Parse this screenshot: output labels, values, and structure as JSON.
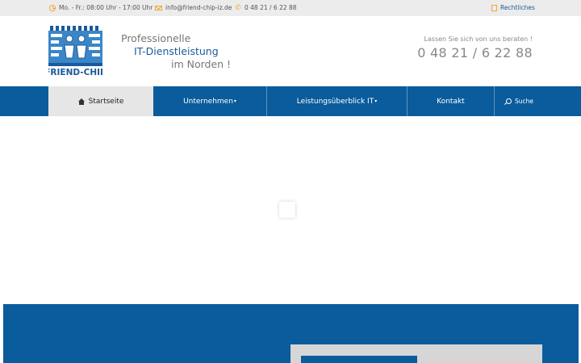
{
  "topbar": {
    "hours": "Mo. - Fr.: 08:00 Uhr - 17:00 Uhr",
    "email": "info@friend-chip-iz.de",
    "phone": "0 48 21 / 6 22 88",
    "legal": "Rechtliches"
  },
  "header": {
    "logo_text": "FRIEND-CHIP",
    "tagline_1": "Professionelle",
    "tagline_2": "IT-Dienstleistung",
    "tagline_3": "im Norden !",
    "contact_prompt": "Lassen Sie sich von uns beraten !",
    "contact_phone": "0 48 21 / 6 22 88"
  },
  "nav": {
    "items": [
      {
        "label": "Startseite"
      },
      {
        "label": "Unternehmen"
      },
      {
        "label": "Leistungsüberblick IT"
      },
      {
        "label": "Kontakt"
      }
    ],
    "search_label": "Suche"
  },
  "colors": {
    "brand_blue": "#0a5c9c",
    "accent_orange": "#f0a830",
    "topbar_bg": "#ececec"
  }
}
